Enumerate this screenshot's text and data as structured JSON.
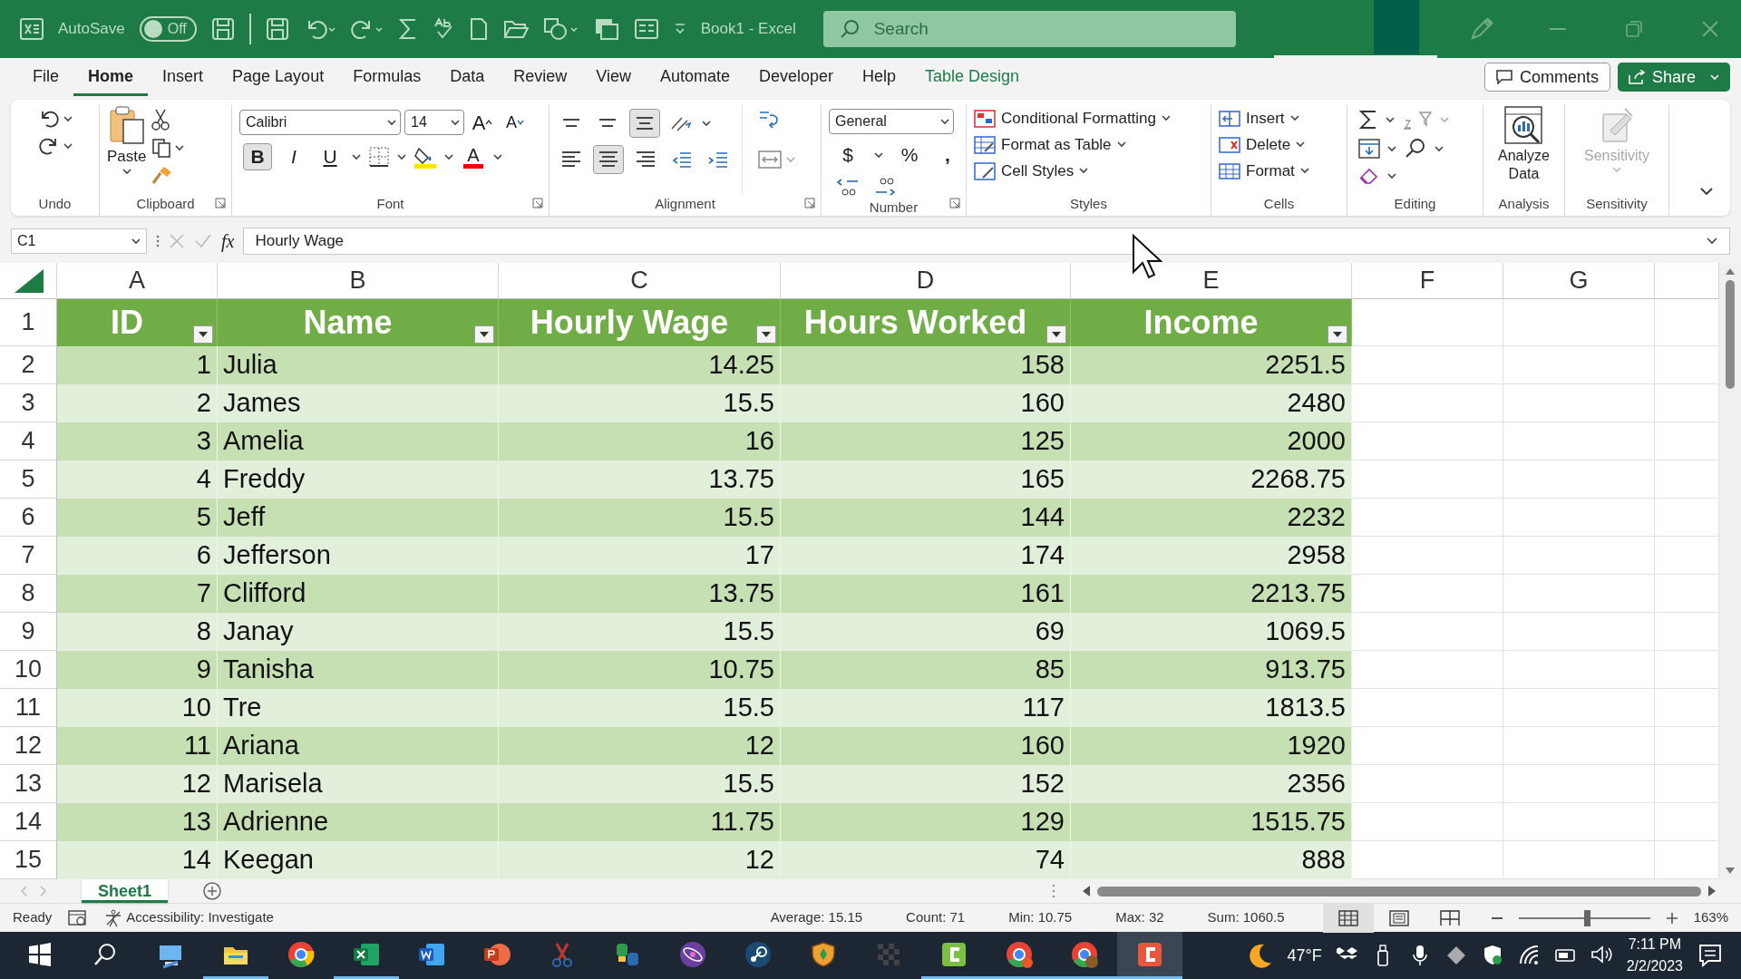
{
  "title_bar": {
    "autosave_label": "AutoSave",
    "autosave_state": "Off",
    "autosave_on": false,
    "file_title": "Book1  -  Excel",
    "search_placeholder": "Search"
  },
  "menu_tabs": [
    {
      "label": "File",
      "selected": false,
      "kind": "normal"
    },
    {
      "label": "Home",
      "selected": true,
      "kind": "normal"
    },
    {
      "label": "Insert",
      "selected": false,
      "kind": "normal"
    },
    {
      "label": "Page Layout",
      "selected": false,
      "kind": "normal"
    },
    {
      "label": "Formulas",
      "selected": false,
      "kind": "normal"
    },
    {
      "label": "Data",
      "selected": false,
      "kind": "normal"
    },
    {
      "label": "Review",
      "selected": false,
      "kind": "normal"
    },
    {
      "label": "View",
      "selected": false,
      "kind": "normal"
    },
    {
      "label": "Automate",
      "selected": false,
      "kind": "normal"
    },
    {
      "label": "Developer",
      "selected": false,
      "kind": "normal"
    },
    {
      "label": "Help",
      "selected": false,
      "kind": "normal"
    },
    {
      "label": "Table Design",
      "selected": false,
      "kind": "contextual"
    }
  ],
  "menu_buttons": [
    {
      "label": "Comments",
      "kind": "outline"
    },
    {
      "label": "Share",
      "kind": "primary"
    }
  ],
  "ribbon": {
    "groups": [
      {
        "kind": "undo",
        "label": "Undo",
        "launcher": false
      },
      {
        "kind": "clipboard",
        "label": "Clipboard",
        "launcher": true,
        "paste_label": "Paste"
      },
      {
        "kind": "font",
        "label": "Font",
        "launcher": true,
        "font_name": "Calibri",
        "font_size": "14",
        "buttons": [
          {
            "label": "A",
            "kind": "grow"
          },
          {
            "label": "A",
            "kind": "shrink"
          },
          {
            "label": "B",
            "kind": "bold",
            "selected": true
          },
          {
            "label": "I",
            "kind": "italic",
            "selected": false
          },
          {
            "label": "U",
            "kind": "underline",
            "selected": false
          }
        ],
        "font_color_label": "A"
      },
      {
        "kind": "alignment",
        "label": "Alignment",
        "launcher": true
      },
      {
        "kind": "number",
        "label": "Number",
        "launcher": true,
        "format": "General",
        "buttons": [
          "$",
          "%",
          ","
        ]
      },
      {
        "kind": "styles",
        "label": "Styles",
        "launcher": false,
        "items": [
          "Conditional Formatting",
          "Format as Table",
          "Cell Styles"
        ]
      },
      {
        "kind": "cells",
        "label": "Cells",
        "launcher": false,
        "items": [
          "Insert",
          "Delete",
          "Format"
        ]
      },
      {
        "kind": "editing",
        "label": "Editing",
        "launcher": false
      },
      {
        "kind": "analysis",
        "label": "Analysis",
        "launcher": false,
        "button_label": "Analyze Data",
        "disabled": false
      },
      {
        "kind": "sensitivity",
        "label": "Sensitivity",
        "launcher": false,
        "button_label": "Sensitivity",
        "disabled": true
      }
    ]
  },
  "formula_bar": {
    "name_box": "C1",
    "function_label": "fx",
    "content": "Hourly Wage"
  },
  "sheet": {
    "columns": [
      "A",
      "B",
      "C",
      "D",
      "E",
      "F",
      "G"
    ],
    "row_numbers": [
      "1",
      "2",
      "3",
      "4",
      "5",
      "6",
      "7",
      "8",
      "9",
      "10",
      "11",
      "12",
      "13",
      "14",
      "15"
    ]
  },
  "table": {
    "columns": [
      {
        "label": "ID"
      },
      {
        "label": "Name"
      },
      {
        "label": "Hourly Wage"
      },
      {
        "label": "Hours Worked"
      },
      {
        "label": "Income"
      }
    ],
    "rows": [
      [
        "1",
        "Julia",
        "14.25",
        "158",
        "2251.5"
      ],
      [
        "2",
        "James",
        "15.5",
        "160",
        "2480"
      ],
      [
        "3",
        "Amelia",
        "16",
        "125",
        "2000"
      ],
      [
        "4",
        "Freddy",
        "13.75",
        "165",
        "2268.75"
      ],
      [
        "5",
        "Jeff",
        "15.5",
        "144",
        "2232"
      ],
      [
        "6",
        "Jefferson",
        "17",
        "174",
        "2958"
      ],
      [
        "7",
        "Clifford",
        "13.75",
        "161",
        "2213.75"
      ],
      [
        "8",
        "Janay",
        "15.5",
        "69",
        "1069.5"
      ],
      [
        "9",
        "Tanisha",
        "10.75",
        "85",
        "913.75"
      ],
      [
        "10",
        "Tre",
        "15.5",
        "117",
        "1813.5"
      ],
      [
        "11",
        "Ariana",
        "12",
        "160",
        "1920"
      ],
      [
        "12",
        "Marisela",
        "15.5",
        "152",
        "2356"
      ],
      [
        "13",
        "Adrienne",
        "11.75",
        "129",
        "1515.75"
      ],
      [
        "14",
        "Keegan",
        "12",
        "74",
        "888"
      ]
    ]
  },
  "sheet_tabs": [
    {
      "label": "Sheet1",
      "selected": true
    }
  ],
  "status_bar": {
    "mode": "Ready",
    "accessibility": "Accessibility: Investigate",
    "stats": [
      "Average: 15.15",
      "Count: 71",
      "Min: 10.75",
      "Max: 32",
      "Sum: 1060.5"
    ],
    "views": [
      {
        "kind": "normal",
        "selected": true
      },
      {
        "kind": "page_layout",
        "selected": false
      },
      {
        "kind": "page_break",
        "selected": false
      }
    ],
    "zoom": {
      "level": 0.52,
      "reading": "163%"
    }
  },
  "taskbar": {
    "apps": [
      {
        "running": false,
        "selected": false
      },
      {
        "running": true,
        "selected": false
      },
      {
        "running": false,
        "selected": false
      },
      {
        "running": true,
        "selected": false
      },
      {
        "running": false,
        "selected": false
      },
      {
        "running": false,
        "selected": false
      },
      {
        "running": false,
        "selected": false
      },
      {
        "running": false,
        "selected": false
      },
      {
        "running": false,
        "selected": false
      },
      {
        "running": false,
        "selected": false
      },
      {
        "running": false,
        "selected": false
      },
      {
        "running": false,
        "selected": false
      },
      {
        "running": true,
        "selected": false
      },
      {
        "running": true,
        "selected": false
      },
      {
        "running": true,
        "selected": false
      },
      {
        "running": true,
        "selected": true
      }
    ],
    "temperature": "47°F",
    "time": "7:11 PM",
    "date": "2/2/2023"
  }
}
